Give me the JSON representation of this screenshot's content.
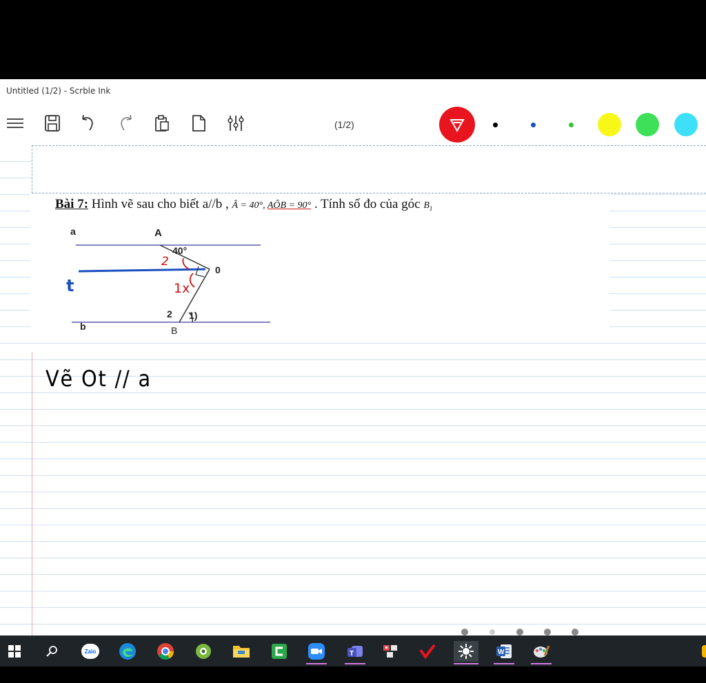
{
  "window": {
    "title": "Untitled (1/2) - Scrble Ink"
  },
  "toolbar": {
    "page_indicator": "(1/2)",
    "tools": [
      "menu-icon",
      "save-icon",
      "undo-icon",
      "redo-icon",
      "clipboard-icon",
      "page-icon",
      "settings-sliders-icon"
    ],
    "pen_color": "#e8141e",
    "colors": [
      {
        "name": "black-small",
        "hex": "#000000"
      },
      {
        "name": "blue-small",
        "hex": "#1a4fc0"
      },
      {
        "name": "green-small",
        "hex": "#36c236"
      },
      {
        "name": "yellow",
        "hex": "#f8f818"
      },
      {
        "name": "green",
        "hex": "#3ee05a"
      },
      {
        "name": "cyan",
        "hex": "#3ee0f8"
      }
    ]
  },
  "problem": {
    "label": "Bài 7:",
    "text_a": " Hình vẽ sau cho biết a//b , ",
    "angle_a": "Â = 40°, ",
    "angle_aob": "AÔB = 90°",
    "text_b": "  . Tính số đo của góc ",
    "angle_b1": "B",
    "angle_b1_sub": "1"
  },
  "figure": {
    "label_a_line": "a",
    "label_A": "A",
    "label_40": "40°",
    "label_2_top": "2",
    "label_O": "0",
    "label_t": "t",
    "label_1x": "1x",
    "label_2_bottom": "2",
    "label_1_bottom": "1)",
    "label_b_line": "b",
    "label_B": "B"
  },
  "handwriting": {
    "text": "Vẽ  Ot // a"
  },
  "taskbar": {
    "icons": [
      "windows-start-icon",
      "search-icon",
      "zalo-icon",
      "edge-icon",
      "chrome-icon",
      "greenshot-icon",
      "file-explorer-icon",
      "camtasia-icon",
      "zoom-icon",
      "teams-icon",
      "snipping-icon",
      "vietkey-icon",
      "brightness-icon",
      "word-icon",
      "paint-icon"
    ],
    "zalo_label": "Zalo"
  }
}
